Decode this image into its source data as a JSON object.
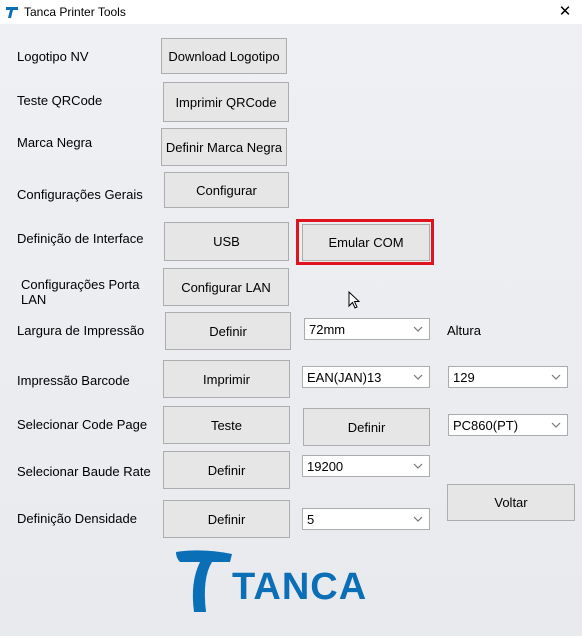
{
  "window": {
    "title": "Tanca Printer Tools",
    "close_label": "✕"
  },
  "labels": {
    "logotipo": "Logotipo NV",
    "qrcode": "Teste QRCode",
    "marca_negra": "Marca Negra",
    "config_gerais": "Configurações Gerais",
    "interface": "Definição de Interface",
    "porta_lan_line1": "Configurações Porta",
    "porta_lan_line2": "LAN",
    "largura": "Largura de Impressão",
    "altura": "Altura",
    "barcode": "Impressão Barcode",
    "code_page": "Selecionar Code Page",
    "baude_rate": "Selecionar Baude Rate",
    "densidade": "Definição Densidade"
  },
  "buttons": {
    "download_logotipo": "Download Logotipo",
    "imprimir_qrcode": "Imprimir QRCode",
    "definir_marca_negra": "Definir Marca Negra",
    "configurar": "Configurar",
    "usb": "USB",
    "emular_com": "Emular COM",
    "configurar_lan": "Configurar LAN",
    "definir_largura": "Definir",
    "imprimir_barcode": "Imprimir",
    "teste_code_page": "Teste",
    "definir_code_page": "Definir",
    "definir_baude": "Definir",
    "definir_densidade": "Definir",
    "voltar": "Voltar"
  },
  "selects": {
    "largura": "72mm",
    "barcode_type": "EAN(JAN)13",
    "altura": "129",
    "code_page": "PC860(PT)",
    "baude_rate": "19200",
    "densidade": "5"
  },
  "logo": {
    "text": "TANCA",
    "color": "#0a6fb7"
  },
  "highlight": {
    "color": "#e0141e"
  }
}
